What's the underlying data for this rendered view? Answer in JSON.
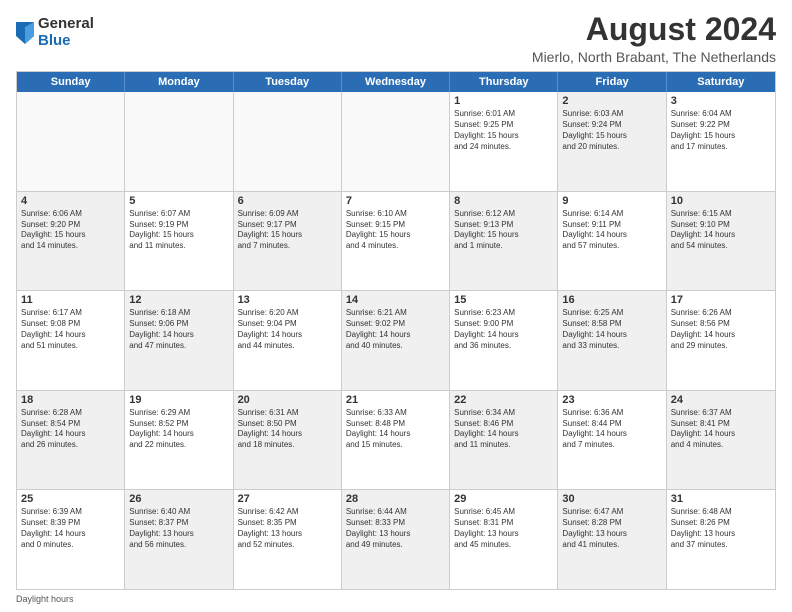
{
  "logo": {
    "general": "General",
    "blue": "Blue"
  },
  "title": "August 2024",
  "subtitle": "Mierlo, North Brabant, The Netherlands",
  "days_of_week": [
    "Sunday",
    "Monday",
    "Tuesday",
    "Wednesday",
    "Thursday",
    "Friday",
    "Saturday"
  ],
  "weeks": [
    [
      {
        "day": "",
        "info": "",
        "shaded": false,
        "empty": true
      },
      {
        "day": "",
        "info": "",
        "shaded": false,
        "empty": true
      },
      {
        "day": "",
        "info": "",
        "shaded": false,
        "empty": true
      },
      {
        "day": "",
        "info": "",
        "shaded": false,
        "empty": true
      },
      {
        "day": "1",
        "info": "Sunrise: 6:01 AM\nSunset: 9:25 PM\nDaylight: 15 hours\nand 24 minutes.",
        "shaded": false,
        "empty": false
      },
      {
        "day": "2",
        "info": "Sunrise: 6:03 AM\nSunset: 9:24 PM\nDaylight: 15 hours\nand 20 minutes.",
        "shaded": true,
        "empty": false
      },
      {
        "day": "3",
        "info": "Sunrise: 6:04 AM\nSunset: 9:22 PM\nDaylight: 15 hours\nand 17 minutes.",
        "shaded": false,
        "empty": false
      }
    ],
    [
      {
        "day": "4",
        "info": "Sunrise: 6:06 AM\nSunset: 9:20 PM\nDaylight: 15 hours\nand 14 minutes.",
        "shaded": true,
        "empty": false
      },
      {
        "day": "5",
        "info": "Sunrise: 6:07 AM\nSunset: 9:19 PM\nDaylight: 15 hours\nand 11 minutes.",
        "shaded": false,
        "empty": false
      },
      {
        "day": "6",
        "info": "Sunrise: 6:09 AM\nSunset: 9:17 PM\nDaylight: 15 hours\nand 7 minutes.",
        "shaded": true,
        "empty": false
      },
      {
        "day": "7",
        "info": "Sunrise: 6:10 AM\nSunset: 9:15 PM\nDaylight: 15 hours\nand 4 minutes.",
        "shaded": false,
        "empty": false
      },
      {
        "day": "8",
        "info": "Sunrise: 6:12 AM\nSunset: 9:13 PM\nDaylight: 15 hours\nand 1 minute.",
        "shaded": true,
        "empty": false
      },
      {
        "day": "9",
        "info": "Sunrise: 6:14 AM\nSunset: 9:11 PM\nDaylight: 14 hours\nand 57 minutes.",
        "shaded": false,
        "empty": false
      },
      {
        "day": "10",
        "info": "Sunrise: 6:15 AM\nSunset: 9:10 PM\nDaylight: 14 hours\nand 54 minutes.",
        "shaded": true,
        "empty": false
      }
    ],
    [
      {
        "day": "11",
        "info": "Sunrise: 6:17 AM\nSunset: 9:08 PM\nDaylight: 14 hours\nand 51 minutes.",
        "shaded": false,
        "empty": false
      },
      {
        "day": "12",
        "info": "Sunrise: 6:18 AM\nSunset: 9:06 PM\nDaylight: 14 hours\nand 47 minutes.",
        "shaded": true,
        "empty": false
      },
      {
        "day": "13",
        "info": "Sunrise: 6:20 AM\nSunset: 9:04 PM\nDaylight: 14 hours\nand 44 minutes.",
        "shaded": false,
        "empty": false
      },
      {
        "day": "14",
        "info": "Sunrise: 6:21 AM\nSunset: 9:02 PM\nDaylight: 14 hours\nand 40 minutes.",
        "shaded": true,
        "empty": false
      },
      {
        "day": "15",
        "info": "Sunrise: 6:23 AM\nSunset: 9:00 PM\nDaylight: 14 hours\nand 36 minutes.",
        "shaded": false,
        "empty": false
      },
      {
        "day": "16",
        "info": "Sunrise: 6:25 AM\nSunset: 8:58 PM\nDaylight: 14 hours\nand 33 minutes.",
        "shaded": true,
        "empty": false
      },
      {
        "day": "17",
        "info": "Sunrise: 6:26 AM\nSunset: 8:56 PM\nDaylight: 14 hours\nand 29 minutes.",
        "shaded": false,
        "empty": false
      }
    ],
    [
      {
        "day": "18",
        "info": "Sunrise: 6:28 AM\nSunset: 8:54 PM\nDaylight: 14 hours\nand 26 minutes.",
        "shaded": true,
        "empty": false
      },
      {
        "day": "19",
        "info": "Sunrise: 6:29 AM\nSunset: 8:52 PM\nDaylight: 14 hours\nand 22 minutes.",
        "shaded": false,
        "empty": false
      },
      {
        "day": "20",
        "info": "Sunrise: 6:31 AM\nSunset: 8:50 PM\nDaylight: 14 hours\nand 18 minutes.",
        "shaded": true,
        "empty": false
      },
      {
        "day": "21",
        "info": "Sunrise: 6:33 AM\nSunset: 8:48 PM\nDaylight: 14 hours\nand 15 minutes.",
        "shaded": false,
        "empty": false
      },
      {
        "day": "22",
        "info": "Sunrise: 6:34 AM\nSunset: 8:46 PM\nDaylight: 14 hours\nand 11 minutes.",
        "shaded": true,
        "empty": false
      },
      {
        "day": "23",
        "info": "Sunrise: 6:36 AM\nSunset: 8:44 PM\nDaylight: 14 hours\nand 7 minutes.",
        "shaded": false,
        "empty": false
      },
      {
        "day": "24",
        "info": "Sunrise: 6:37 AM\nSunset: 8:41 PM\nDaylight: 14 hours\nand 4 minutes.",
        "shaded": true,
        "empty": false
      }
    ],
    [
      {
        "day": "25",
        "info": "Sunrise: 6:39 AM\nSunset: 8:39 PM\nDaylight: 14 hours\nand 0 minutes.",
        "shaded": false,
        "empty": false
      },
      {
        "day": "26",
        "info": "Sunrise: 6:40 AM\nSunset: 8:37 PM\nDaylight: 13 hours\nand 56 minutes.",
        "shaded": true,
        "empty": false
      },
      {
        "day": "27",
        "info": "Sunrise: 6:42 AM\nSunset: 8:35 PM\nDaylight: 13 hours\nand 52 minutes.",
        "shaded": false,
        "empty": false
      },
      {
        "day": "28",
        "info": "Sunrise: 6:44 AM\nSunset: 8:33 PM\nDaylight: 13 hours\nand 49 minutes.",
        "shaded": true,
        "empty": false
      },
      {
        "day": "29",
        "info": "Sunrise: 6:45 AM\nSunset: 8:31 PM\nDaylight: 13 hours\nand 45 minutes.",
        "shaded": false,
        "empty": false
      },
      {
        "day": "30",
        "info": "Sunrise: 6:47 AM\nSunset: 8:28 PM\nDaylight: 13 hours\nand 41 minutes.",
        "shaded": true,
        "empty": false
      },
      {
        "day": "31",
        "info": "Sunrise: 6:48 AM\nSunset: 8:26 PM\nDaylight: 13 hours\nand 37 minutes.",
        "shaded": false,
        "empty": false
      }
    ]
  ],
  "footer": "Daylight hours"
}
